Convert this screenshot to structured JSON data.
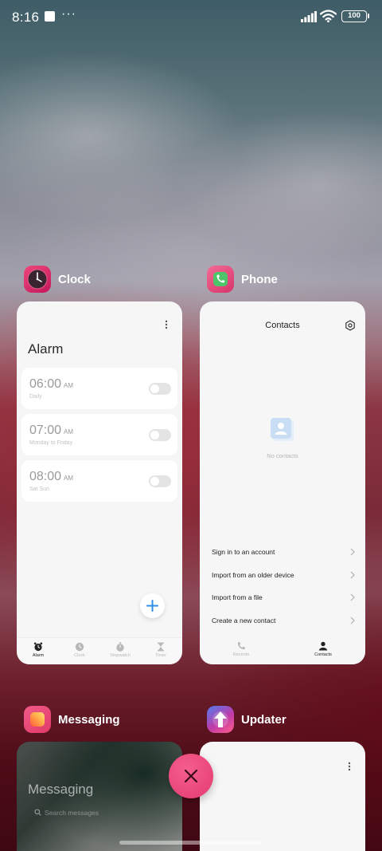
{
  "status_bar": {
    "time": "8:16",
    "dots": "···",
    "battery": "100"
  },
  "clock_app": {
    "name": "Clock",
    "screen_title": "Alarm",
    "alarms": [
      {
        "time": "06:00",
        "ampm": "AM",
        "repeat": "Daily",
        "enabled": false
      },
      {
        "time": "07:00",
        "ampm": "AM",
        "repeat": "Monday to Friday",
        "enabled": false
      },
      {
        "time": "08:00",
        "ampm": "AM",
        "repeat": "Sat Sun",
        "enabled": false
      }
    ],
    "nav": [
      {
        "label": "Alarm",
        "icon": "alarm-icon",
        "active": true
      },
      {
        "label": "Clock",
        "icon": "clock-icon",
        "active": false
      },
      {
        "label": "Stopwatch",
        "icon": "stopwatch-icon",
        "active": false
      },
      {
        "label": "Timer",
        "icon": "hourglass-icon",
        "active": false
      }
    ]
  },
  "phone_app": {
    "name": "Phone",
    "screen_title": "Contacts",
    "empty_label": "No contacts",
    "menu": [
      {
        "label": "Sign in to an account"
      },
      {
        "label": "Import from an older device"
      },
      {
        "label": "Import from a file"
      },
      {
        "label": "Create a new contact"
      }
    ],
    "nav": [
      {
        "label": "Recents",
        "icon": "phone-icon",
        "active": false
      },
      {
        "label": "Contacts",
        "icon": "person-icon",
        "active": true
      }
    ]
  },
  "messaging_app": {
    "name": "Messaging",
    "screen_title": "Messaging",
    "search_placeholder": "Search messages"
  },
  "updater_app": {
    "name": "Updater"
  },
  "colors": {
    "accent_blue": "#2f8ee8",
    "close_pink": "#e8467a"
  }
}
